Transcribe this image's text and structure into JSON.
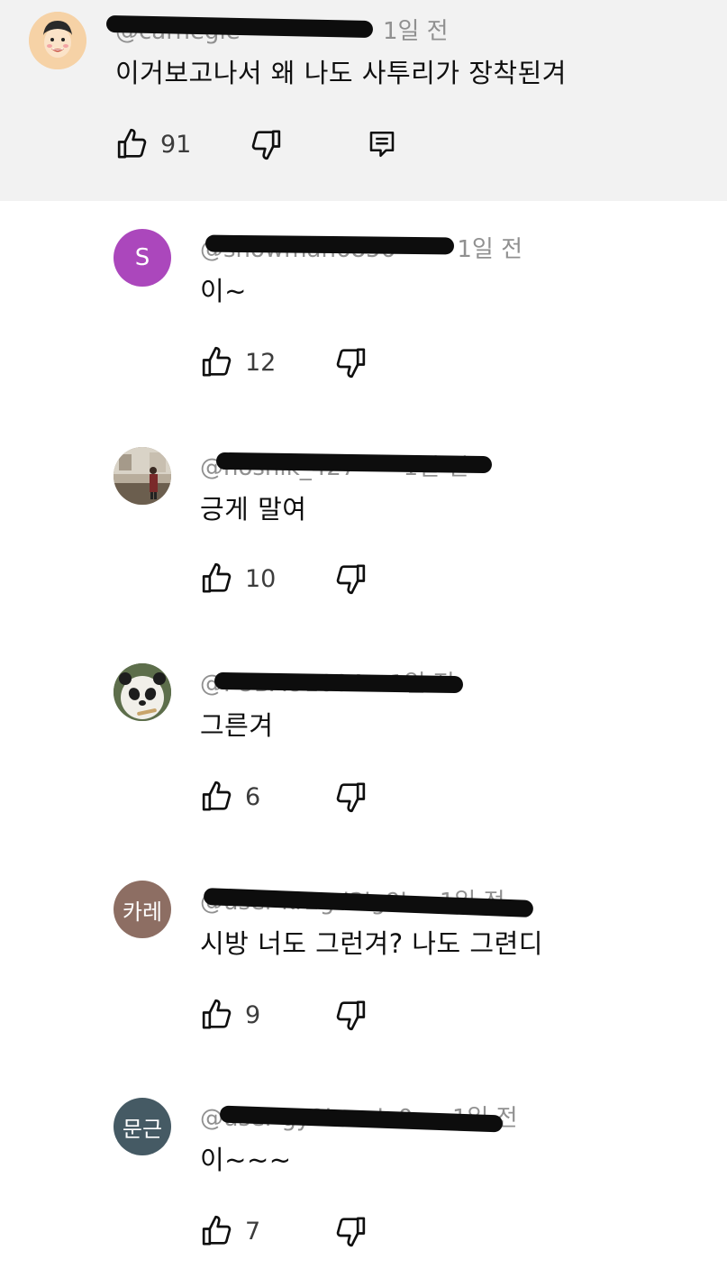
{
  "comments": [
    {
      "handle": "@carnegie",
      "time": "1일 전",
      "text": "이거보고나서 왜 나도 사투리가 장착된겨",
      "likes": "91",
      "avatar": {
        "kind": "illustration",
        "bg": "#f6d2a6"
      }
    },
    {
      "handle": "@snowman6856",
      "time": "1일 전",
      "text": "이~",
      "likes": "12",
      "avatar": {
        "kind": "letter",
        "letter": "S",
        "bg": "#ab47bc"
      }
    },
    {
      "handle": "@hoshik_427",
      "time": "1일 전",
      "text": "긍게 말여",
      "likes": "10",
      "avatar": {
        "kind": "photo",
        "bg": "#8a7a66"
      }
    },
    {
      "handle": "@FUBAO1004",
      "time": "1일 전",
      "text": "그른겨",
      "likes": "6",
      "avatar": {
        "kind": "panda",
        "bg": "#5a6b4a"
      }
    },
    {
      "handle": "@user-kr2gd3lg9k",
      "time": "1일 전",
      "text": "시방 너도 그런겨? 나도 그련디",
      "likes": "9",
      "avatar": {
        "kind": "letter",
        "letter": "카레",
        "bg": "#8d6e63"
      }
    },
    {
      "handle": "@user-gy2bmolo0x",
      "time": "1일 전",
      "text": "이~~~",
      "likes": "7",
      "avatar": {
        "kind": "letter",
        "letter": "문근",
        "bg": "#455a64"
      }
    }
  ],
  "icons": {
    "like": "thumbs-up-icon",
    "dislike": "thumbs-down-icon",
    "reply": "reply-icon"
  }
}
